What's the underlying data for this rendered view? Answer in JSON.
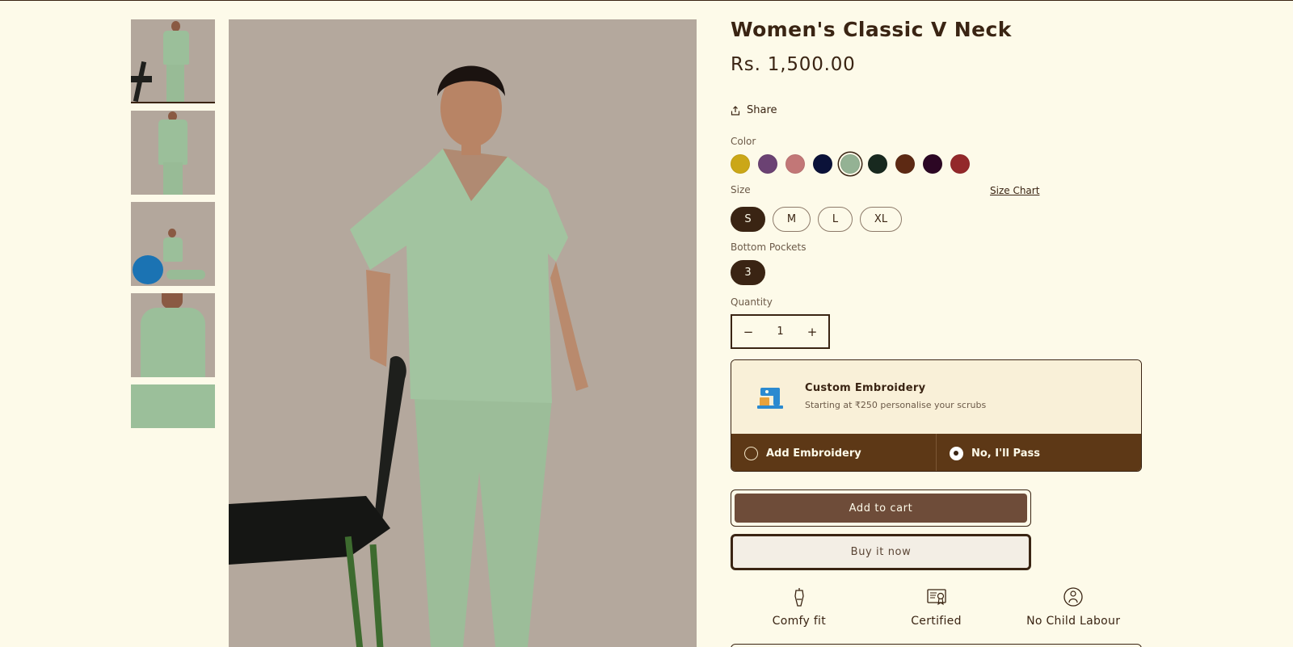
{
  "product": {
    "title": "Women's Classic V Neck",
    "price": "Rs. 1,500.00",
    "share_label": "Share"
  },
  "color": {
    "label": "Color",
    "swatches": [
      {
        "name": "mustard",
        "hex": "#cba717"
      },
      {
        "name": "plum",
        "hex": "#6b4273"
      },
      {
        "name": "rose",
        "hex": "#c27777"
      },
      {
        "name": "navy",
        "hex": "#0b1239"
      },
      {
        "name": "sage",
        "hex": "#94b294",
        "selected": true
      },
      {
        "name": "dark-green",
        "hex": "#18291f"
      },
      {
        "name": "brown",
        "hex": "#5d2913"
      },
      {
        "name": "aubergine",
        "hex": "#2c0724"
      },
      {
        "name": "red",
        "hex": "#93282a"
      }
    ]
  },
  "size": {
    "label": "Size",
    "chart_link": "Size Chart",
    "options": [
      "S",
      "M",
      "L",
      "XL"
    ],
    "selected": "S"
  },
  "bottom_pockets": {
    "label": "Bottom Pockets",
    "options": [
      "3"
    ],
    "selected": "3"
  },
  "quantity": {
    "label": "Quantity",
    "value": "1",
    "minus": "−",
    "plus": "+"
  },
  "embroidery": {
    "title": "Custom Embroidery",
    "subtitle": "Starting at ₹250 personalise your scrubs",
    "options": [
      {
        "label": "Add Embroidery",
        "selected": false
      },
      {
        "label": "No, I'll Pass",
        "selected": true
      }
    ],
    "icon": "sewing-machine-icon"
  },
  "actions": {
    "add_to_cart": "Add to cart",
    "buy_now": "Buy it now"
  },
  "features": [
    {
      "label": "Comfy fit",
      "icon": "dress-form-icon"
    },
    {
      "label": "Certified",
      "icon": "certificate-icon"
    },
    {
      "label": "No Child Labour",
      "icon": "child-labour-icon"
    }
  ],
  "colors": {
    "background": "#fdfae9",
    "text": "#3a2413",
    "accent_brown": "#5d3816",
    "cart_button": "#6e4c39",
    "image_bg": "#b4a89d"
  }
}
